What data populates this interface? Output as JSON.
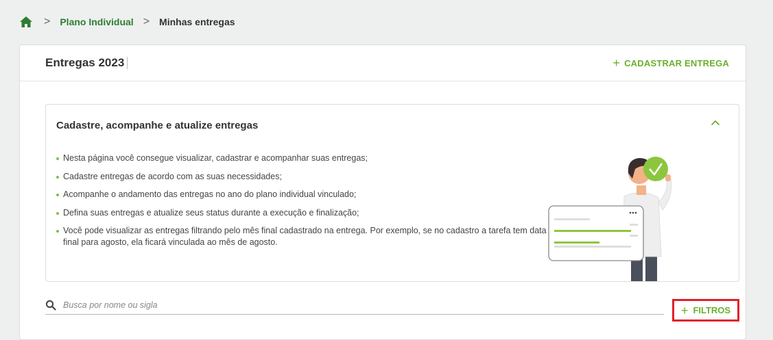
{
  "breadcrumb": {
    "home_icon": "home-icon",
    "separator": ">",
    "link": "Plano Individual",
    "current": "Minhas entregas"
  },
  "card": {
    "title": "Entregas 2023",
    "add_button": {
      "plus": "+",
      "label": "CADASTRAR ENTREGA"
    }
  },
  "info": {
    "title": "Cadastre, acompanhe e atualize entregas",
    "collapse_icon": "chevron-up-icon",
    "items": [
      "Nesta página você consegue visualizar, cadastrar e acompanhar suas entregas;",
      "Cadastre entregas de acordo com as suas necessidades;",
      "Acompanhe o andamento das entregas no ano do plano individual vinculado;",
      "Defina suas entregas e atualize seus status durante a execução e finalização;",
      "Você pode visualizar as entregas filtrando pelo mês final cadastrado na entrega. Por exemplo, se no cadastro a tarefa tem data final para agosto, ela ficará vinculada ao mês de agosto."
    ]
  },
  "search": {
    "icon": "search-icon",
    "placeholder": "Busca por nome ou sigla",
    "value": ""
  },
  "filters": {
    "plus": "+",
    "label": "FILTROS"
  },
  "colors": {
    "accent_green": "#6aaf2c",
    "dark_green": "#2e7d32",
    "highlight_red": "#e0202a"
  }
}
